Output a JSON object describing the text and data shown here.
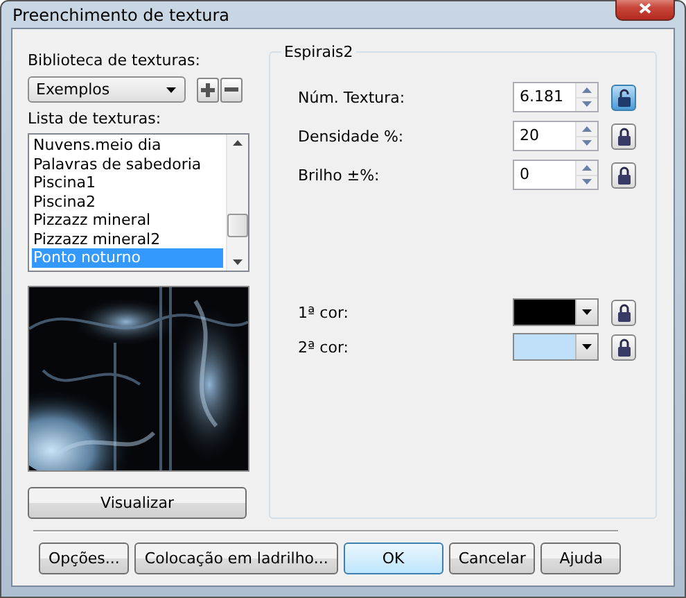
{
  "window": {
    "title": "Preenchimento de textura"
  },
  "library": {
    "label": "Biblioteca de texturas:",
    "value": "Exemplos"
  },
  "texture_list": {
    "label": "Lista de texturas:",
    "items": [
      {
        "label": "Nuvens.meio dia",
        "selected": false
      },
      {
        "label": "Palavras de sabedoria",
        "selected": false
      },
      {
        "label": "Piscina1",
        "selected": false
      },
      {
        "label": "Piscina2",
        "selected": false
      },
      {
        "label": "Pizzazz mineral",
        "selected": false
      },
      {
        "label": "Pizzazz mineral2",
        "selected": false
      },
      {
        "label": "Ponto noturno",
        "selected": true
      }
    ]
  },
  "preview_button": "Visualizar",
  "group": {
    "title": "Espirais2",
    "fields": [
      {
        "label": "Núm. Textura:",
        "value": "6.181",
        "locked": false
      },
      {
        "label": "Densidade %:",
        "value": "20",
        "locked": true
      },
      {
        "label": "Brilho ±%:",
        "value": "0",
        "locked": true
      }
    ],
    "colors": [
      {
        "label": "1ª cor:",
        "color": "#000000",
        "locked": true
      },
      {
        "label": "2ª cor:",
        "color": "#c0dff8",
        "locked": true
      }
    ]
  },
  "buttons": [
    {
      "label": "Opções...",
      "default": false
    },
    {
      "label": "Colocação em ladrilho...",
      "default": false
    },
    {
      "label": "OK",
      "default": true
    },
    {
      "label": "Cancelar",
      "default": false
    },
    {
      "label": "Ajuda",
      "default": false
    }
  ]
}
